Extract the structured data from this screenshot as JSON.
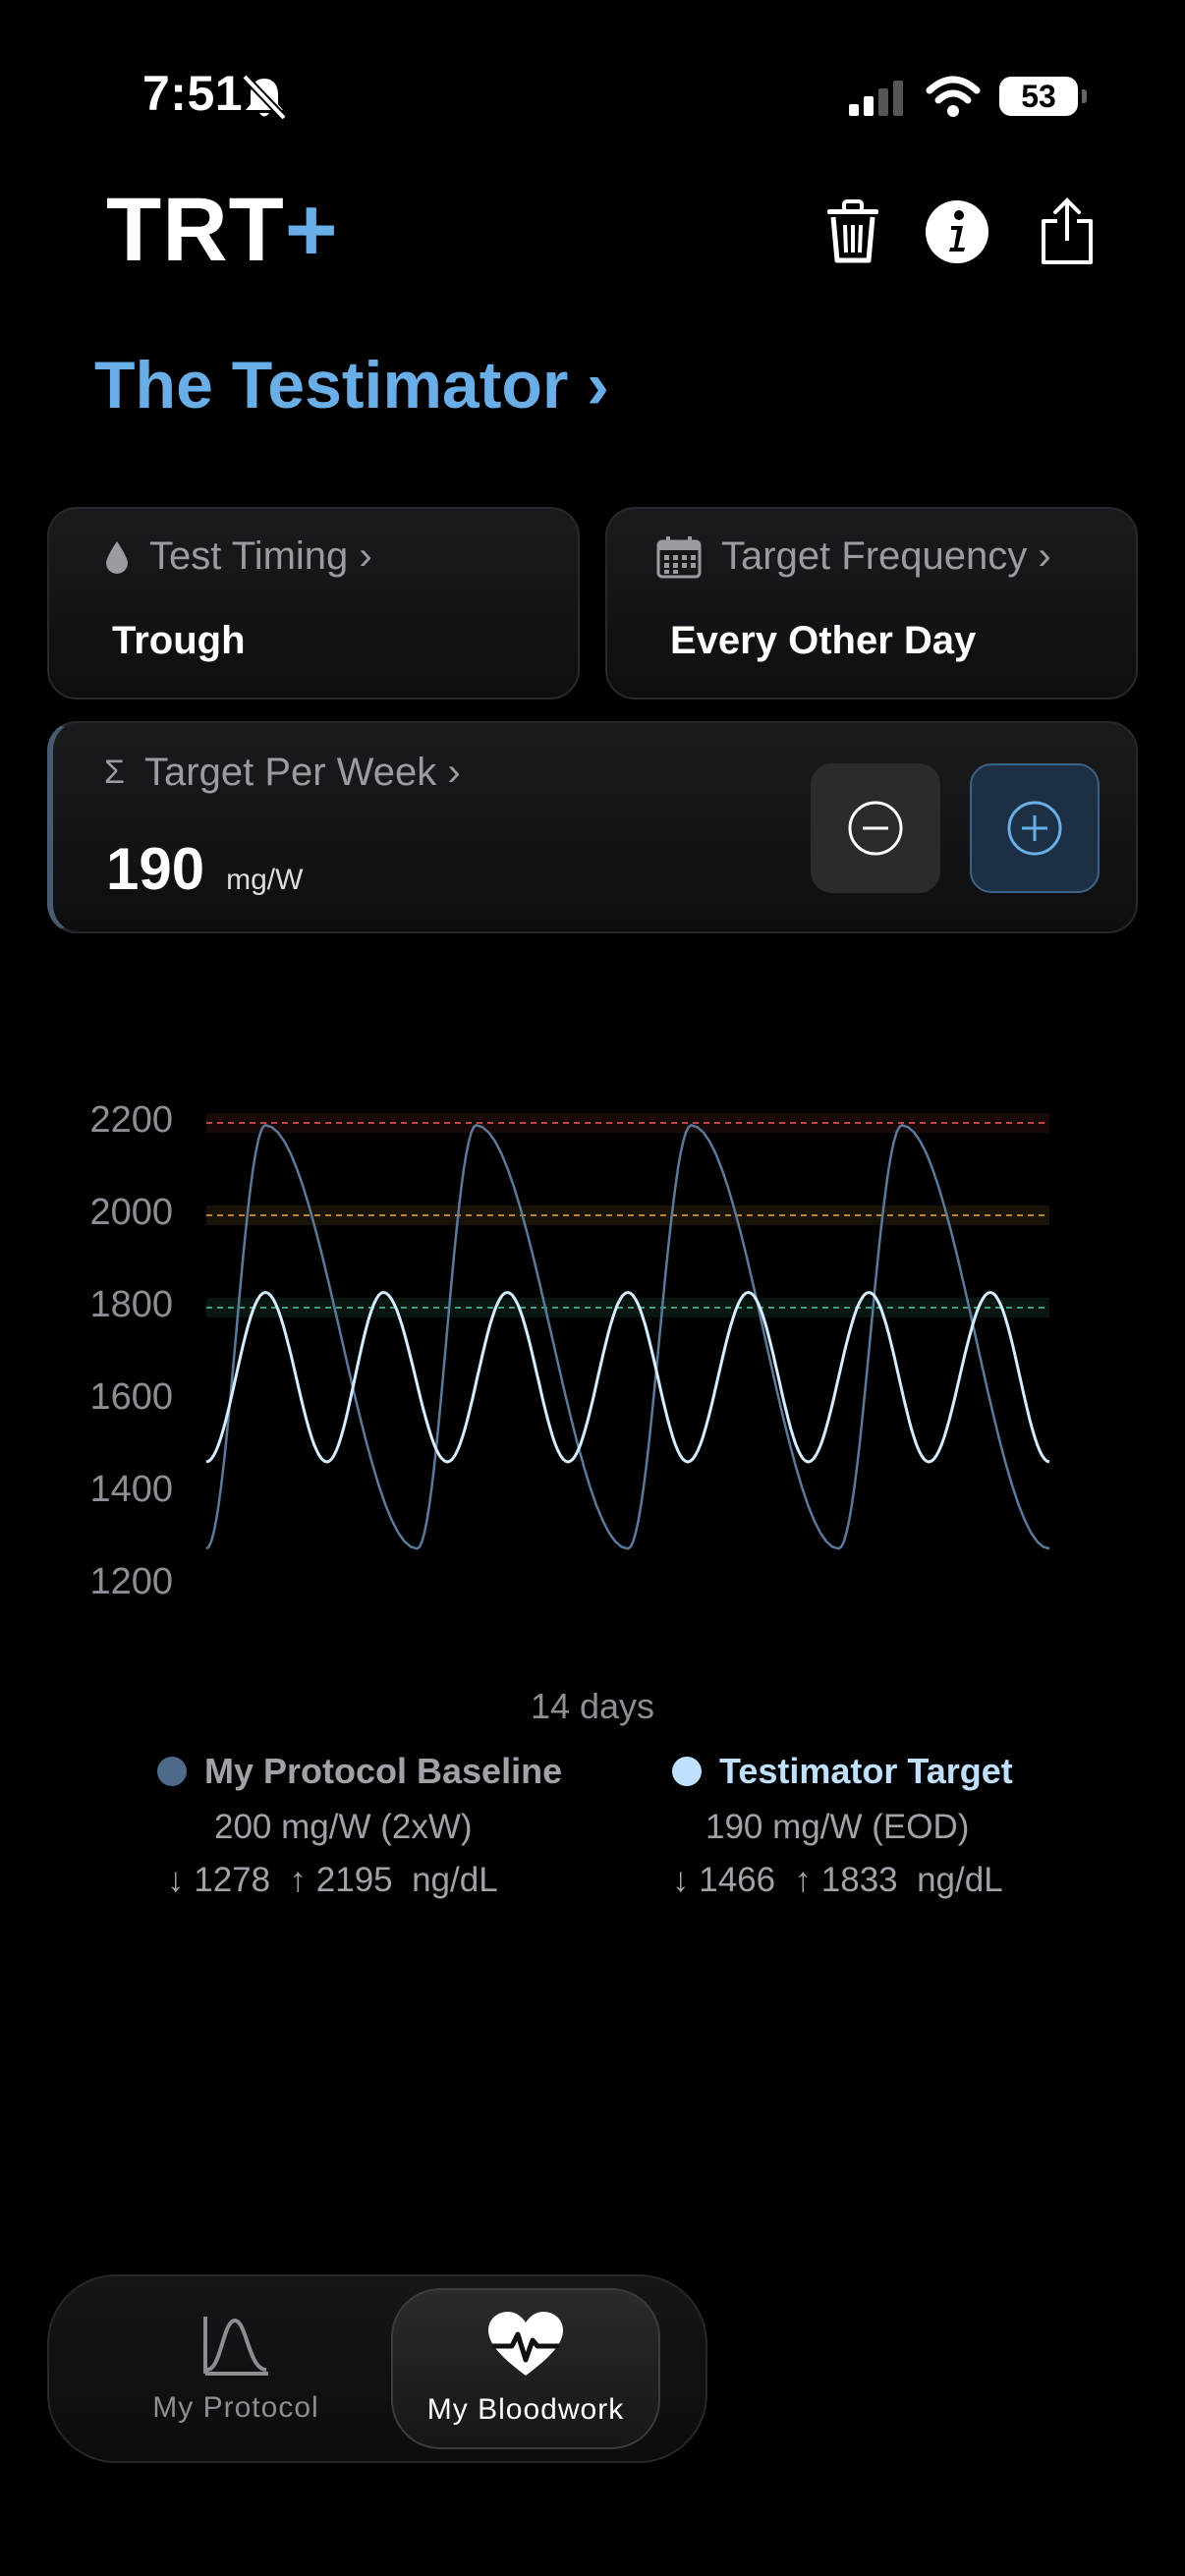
{
  "status_bar": {
    "time": "7:51",
    "battery": "53"
  },
  "header": {
    "logo_main": "TRT",
    "logo_plus": "+",
    "icons": [
      "trash-icon",
      "info-icon",
      "share-icon"
    ]
  },
  "page": {
    "title": "The Testimator ›"
  },
  "cards": {
    "test_timing": {
      "label": "Test Timing ›",
      "value": "Trough"
    },
    "target_frequency": {
      "label": "Target Frequency ›",
      "value": "Every Other Day"
    },
    "target_per_week": {
      "label": "Target Per Week ›",
      "sigma": "Σ",
      "value": "190",
      "unit": "mg/W"
    }
  },
  "chart_data": {
    "type": "line",
    "xlabel": "14 days",
    "ylim": [
      1200,
      2200
    ],
    "yticks": [
      "2200",
      "2000",
      "1800",
      "1600",
      "1400",
      "1200"
    ],
    "reference_lines": [
      {
        "value": 2200,
        "color": "#d24a4a"
      },
      {
        "value": 2000,
        "color": "#c9913a"
      },
      {
        "value": 1800,
        "color": "#3fb08a"
      }
    ],
    "series": [
      {
        "name": "My Protocol Baseline",
        "color": "#5b7a99",
        "min": 1278,
        "max": 2195,
        "peaks_x": [
          0.07,
          0.32,
          0.575,
          0.825
        ],
        "troughs_x": [
          0.0,
          0.25,
          0.5,
          0.75,
          1.0
        ]
      },
      {
        "name": "Testimator Target",
        "color": "#d6ecff",
        "min": 1466,
        "max": 1833,
        "peaks_x": [
          0.07,
          0.21,
          0.357,
          0.5,
          0.643,
          0.786,
          0.93
        ],
        "troughs_x": [
          0.0,
          0.143,
          0.286,
          0.429,
          0.571,
          0.714,
          0.857,
          1.0
        ]
      }
    ]
  },
  "legend": {
    "baseline": {
      "name": "My Protocol Baseline",
      "dose": "200 mg/W (2xW)",
      "range": "↓ 1278  ↑ 2195  ng/dL",
      "color": "#4e6a88"
    },
    "target": {
      "name": "Testimator Target",
      "dose": "190 mg/W (EOD)",
      "range": "↓ 1466  ↑ 1833  ng/dL",
      "color": "#bfe0ff"
    }
  },
  "tabbar": {
    "tabs": [
      {
        "label": "My Protocol",
        "icon": "curve-icon",
        "active": false
      },
      {
        "label": "My Bloodwork",
        "icon": "heart-pulse-icon",
        "active": true
      }
    ]
  }
}
